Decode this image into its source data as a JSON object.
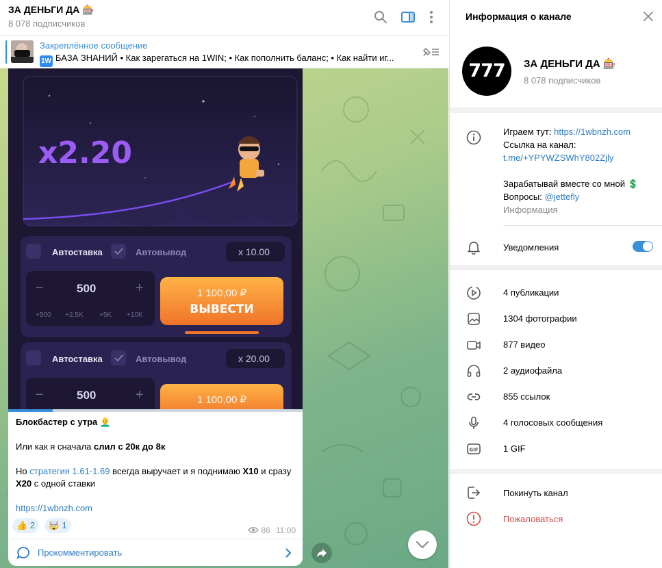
{
  "colors": {
    "accent": "#3a8fd9",
    "danger": "#d44a4a",
    "link": "#2e7cc4"
  },
  "header": {
    "channel_name": "ЗА ДЕНЬГИ ДА 🎰",
    "subscribers": "8 078 подписчиков",
    "icons": [
      "search-icon",
      "side-panel-icon",
      "more-vertical-icon"
    ]
  },
  "pinned": {
    "title": "Закреплённое сообщение",
    "badge": "1W",
    "text": "БАЗА ЗНАНИЙ • Как зарегаться на 1WIN; • Как пополнить баланс; • Как найти иг..."
  },
  "game_screenshot": {
    "multiplier": "x2.20",
    "panels": [
      {
        "autobet_label": "Автоставка",
        "autocashout_label": "Автовывод",
        "cashout_value": "x 10.00",
        "bet": "500",
        "chips": [
          "+500",
          "+2.5K",
          "+5K",
          "+10K"
        ],
        "amount": "1 100,00 ₽",
        "action": "ВЫВЕСТИ"
      },
      {
        "autobet_label": "Автоставка",
        "autocashout_label": "Автовывод",
        "cashout_value": "x 20.00",
        "bet": "500",
        "amount": "1 100,00 ₽"
      }
    ],
    "video_progress": 0.15
  },
  "message": {
    "line1": "Блокбастер с утра 👨‍🦲",
    "line2_plain": "Или как я сначала ",
    "line2_bold": "слил с 20к до 8к",
    "line3_plain1": "Но ",
    "line3_link": "стратегия 1.61-1.69",
    "line3_plain2": " всегда выручает и я поднимаю ",
    "line3_bold1": "X10",
    "line3_plain3": " и сразу ",
    "line3_bold2": "X20",
    "line3_plain4": " с одной ставки",
    "url": "https://1wbnzh.com",
    "reactions": [
      {
        "emoji": "👍",
        "count": "2"
      },
      {
        "emoji": "🤯",
        "count": "1"
      }
    ],
    "views": "86",
    "time": "11:00",
    "comment_label": "Прокомментировать"
  },
  "panel": {
    "title": "Информация о канале",
    "avatar_text": "777",
    "name": "ЗА ДЕНЬГИ ДА 🎰",
    "subscribers": "8 078 подписчиков",
    "info": {
      "play_label": "Играем тут: ",
      "play_link": "https://1wbnzh.com",
      "channel_link_label": "Ссылка на канал:",
      "channel_link": "t.me/+YPYWZSWhY802Zjly",
      "earn": "Зарабатывай вместе со мной 💲",
      "questions_label": "Вопросы: ",
      "questions_link": "@jettefly",
      "caption": "Информация"
    },
    "notifications": {
      "label": "Уведомления",
      "enabled": true
    },
    "stats": [
      {
        "icon": "publications-icon",
        "label": "4 публикации"
      },
      {
        "icon": "photo-icon",
        "label": "1304 фотографии"
      },
      {
        "icon": "video-icon",
        "label": "877 видео"
      },
      {
        "icon": "headphones-icon",
        "label": "2 аудиофайла"
      },
      {
        "icon": "link-icon",
        "label": "855 ссылок"
      },
      {
        "icon": "microphone-icon",
        "label": "4 голосовых сообщения"
      },
      {
        "icon": "gif-icon",
        "label": "1 GIF"
      }
    ],
    "actions": {
      "leave": "Покинуть канал",
      "report": "Пожаловаться"
    }
  }
}
